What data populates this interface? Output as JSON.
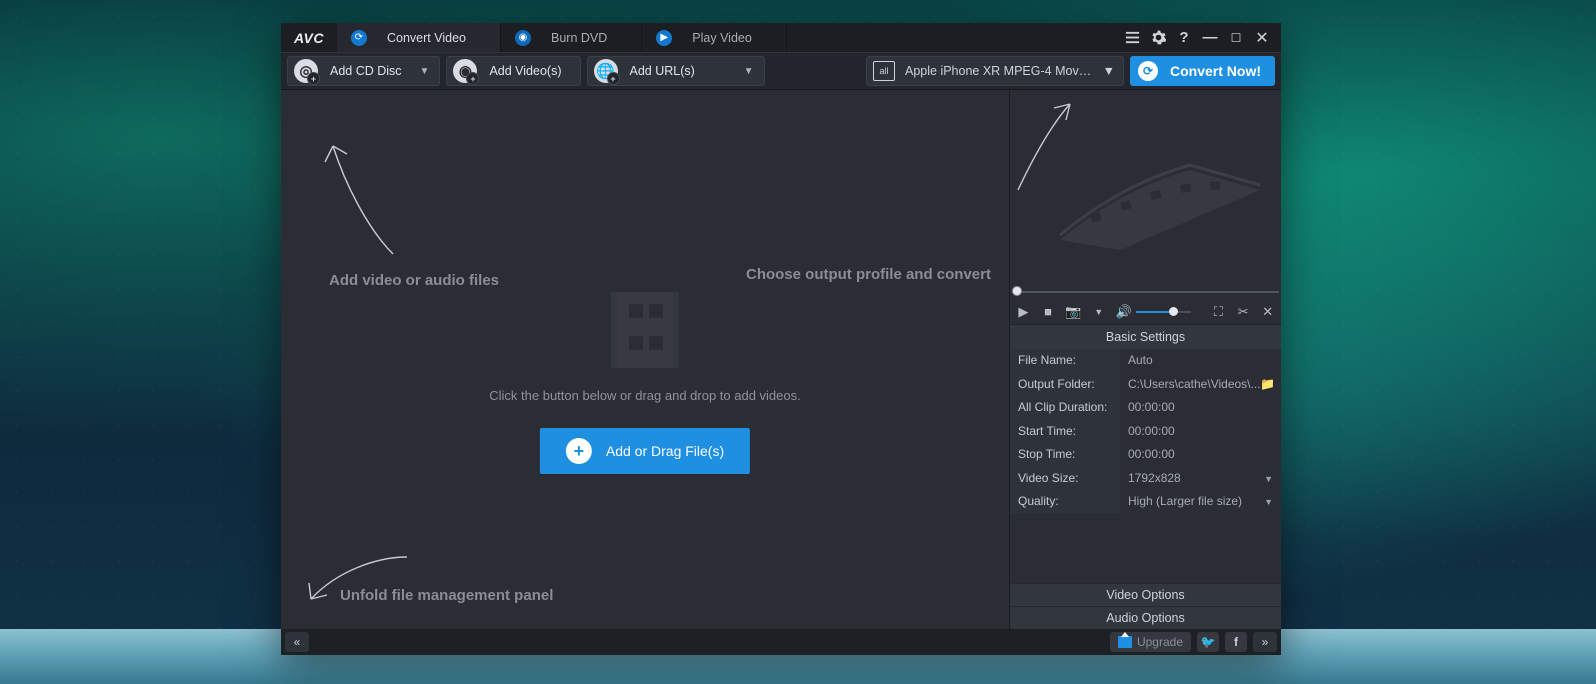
{
  "logo": "AVC",
  "tabs": [
    {
      "label": "Convert Video"
    },
    {
      "label": "Burn DVD"
    },
    {
      "label": "Play Video"
    }
  ],
  "toolbar": {
    "add_cd": "Add CD Disc",
    "add_videos": "Add Video(s)",
    "add_urls": "Add URL(s)",
    "profile_icon": "all",
    "profile": "Apple iPhone XR MPEG-4 Movie (*.m…",
    "convert": "Convert Now!"
  },
  "overlays": {
    "hint_add": "Add video or audio files",
    "hint_profile": "Choose output profile and convert",
    "hint_panel": "Unfold file management panel"
  },
  "stage": {
    "drop_text": "Click the button below or drag and drop to add videos.",
    "add_button": "Add or Drag File(s)"
  },
  "settings": {
    "title": "Basic Settings",
    "file_name_label": "File Name:",
    "file_name": "Auto",
    "output_folder_label": "Output Folder:",
    "output_folder": "C:\\Users\\cathe\\Videos\\...",
    "duration_label": "All Clip Duration:",
    "duration": "00:00:00",
    "start_label": "Start Time:",
    "start": "00:00:00",
    "stop_label": "Stop Time:",
    "stop": "00:00:00",
    "size_label": "Video Size:",
    "size": "1792x828",
    "quality_label": "Quality:",
    "quality": "High (Larger file size)",
    "video_options": "Video Options",
    "audio_options": "Audio Options"
  },
  "footer": {
    "upgrade": "Upgrade"
  }
}
